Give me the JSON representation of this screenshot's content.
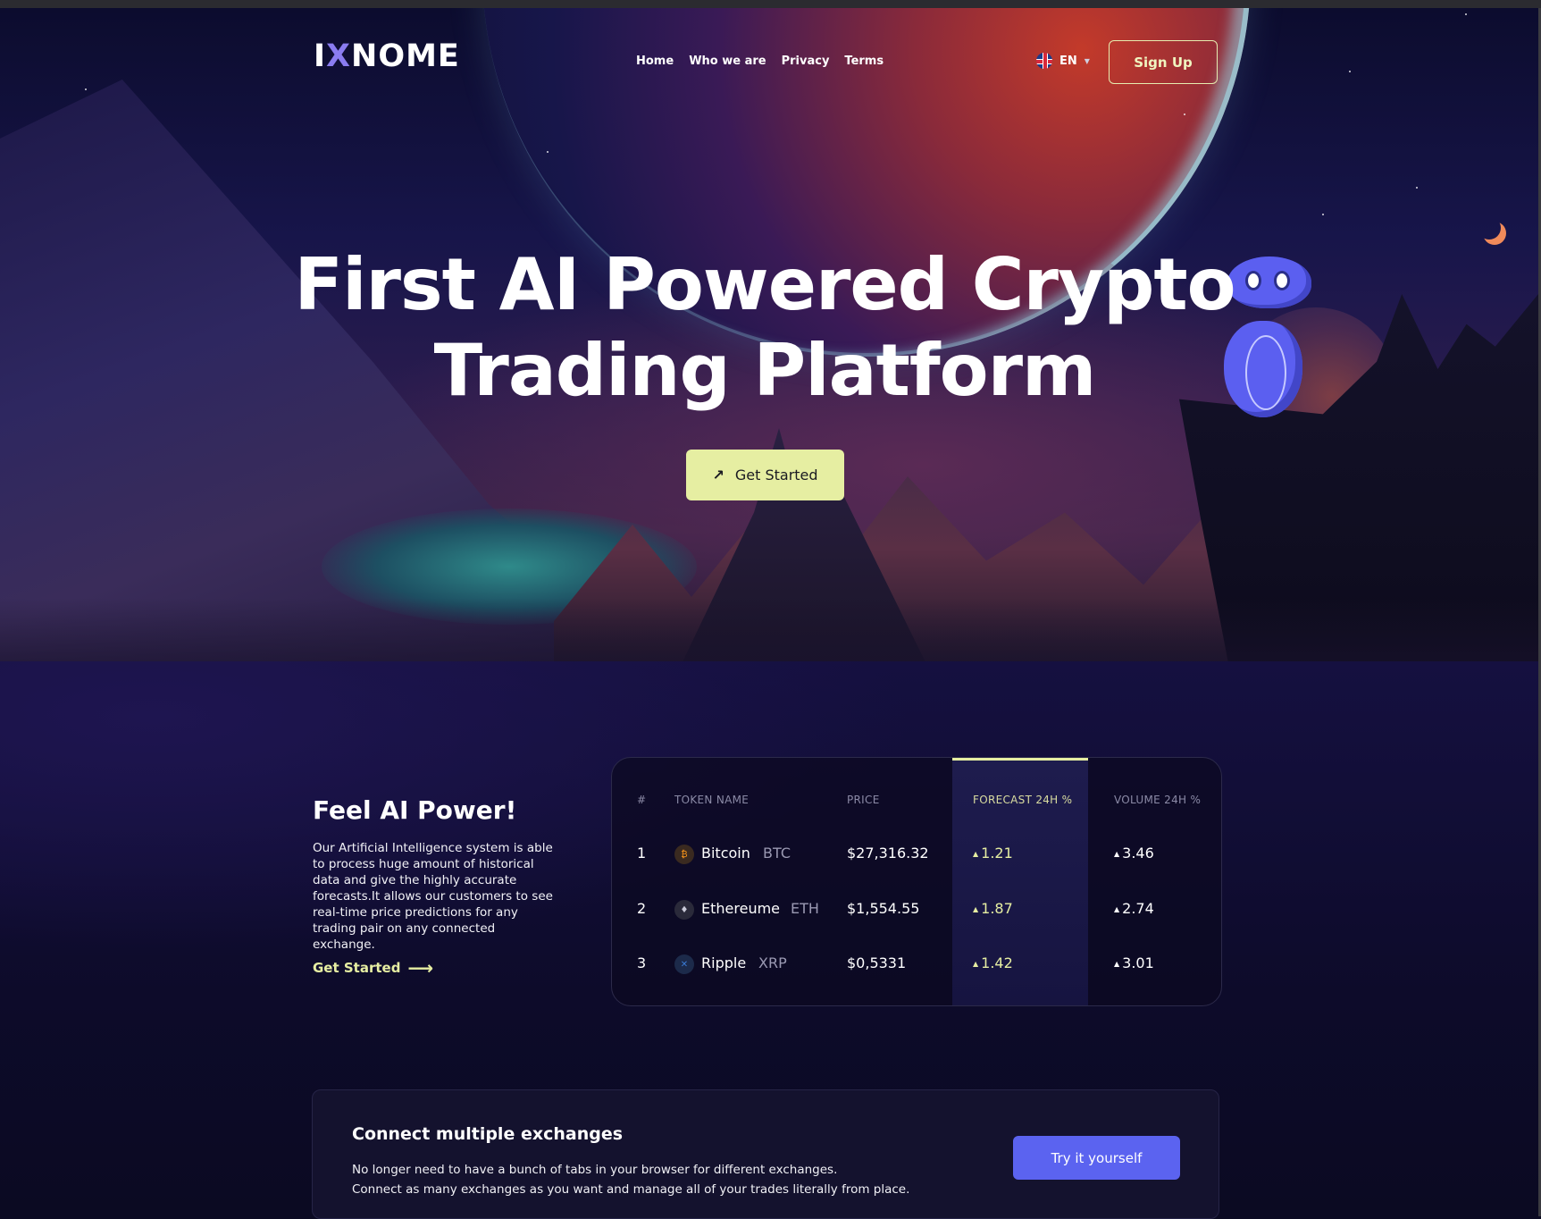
{
  "brand": {
    "logo_prefix": "I",
    "logo_x": "X",
    "logo_suffix": "NOME"
  },
  "nav": {
    "items": [
      "Home",
      "Who we are",
      "Privacy",
      "Terms"
    ]
  },
  "language": {
    "code": "EN",
    "flag": "uk-flag-icon"
  },
  "header": {
    "signup_label": "Sign Up"
  },
  "hero": {
    "title_line1": "First AI Powered Crypto",
    "title_line2": "Trading Platform",
    "cta_label": "Get Started",
    "cta_icon": "arrow-up-right-icon"
  },
  "feature": {
    "title": "Feel AI Power!",
    "text": "Our Artificial Intelligence system is able to process huge amount of historical data and give the highly accurate forecasts.It allows our customers to see real-time price predictions for any trading pair on any connected exchange.",
    "link_label": "Get Started",
    "link_icon": "arrow-right-icon"
  },
  "table": {
    "headers": [
      "#",
      "TOKEN NAME",
      "PRICE",
      "FORECAST 24H %",
      "VOLUME 24H %"
    ],
    "rows": [
      {
        "rank": "1",
        "name": "Bitcoin",
        "symbol": "BTC",
        "price": "$27,316.32",
        "forecast": "1.21",
        "volume": "3.46",
        "icon": "bitcoin-icon",
        "icon_color": "#f7931a"
      },
      {
        "rank": "2",
        "name": "Ethereume",
        "symbol": "ETH",
        "price": "$1,554.55",
        "forecast": "1.87",
        "volume": "2.74",
        "icon": "ethereum-icon",
        "icon_color": "#c9c9d8"
      },
      {
        "rank": "3",
        "name": "Ripple",
        "symbol": "XRP",
        "price": "$0,5331",
        "forecast": "1.42",
        "volume": "3.01",
        "icon": "ripple-icon",
        "icon_color": "#3a7bd5"
      }
    ]
  },
  "connect": {
    "title": "Connect multiple exchanges",
    "line1": "No longer need to have a bunch of tabs in your browser for different exchanges.",
    "line2": "Connect as many exchanges as you want and manage all of your trades literally from place.",
    "button_label": "Try it yourself"
  },
  "colors": {
    "accent": "#e6eea2",
    "primary": "#5b63f0",
    "background": "#0b0a22"
  }
}
